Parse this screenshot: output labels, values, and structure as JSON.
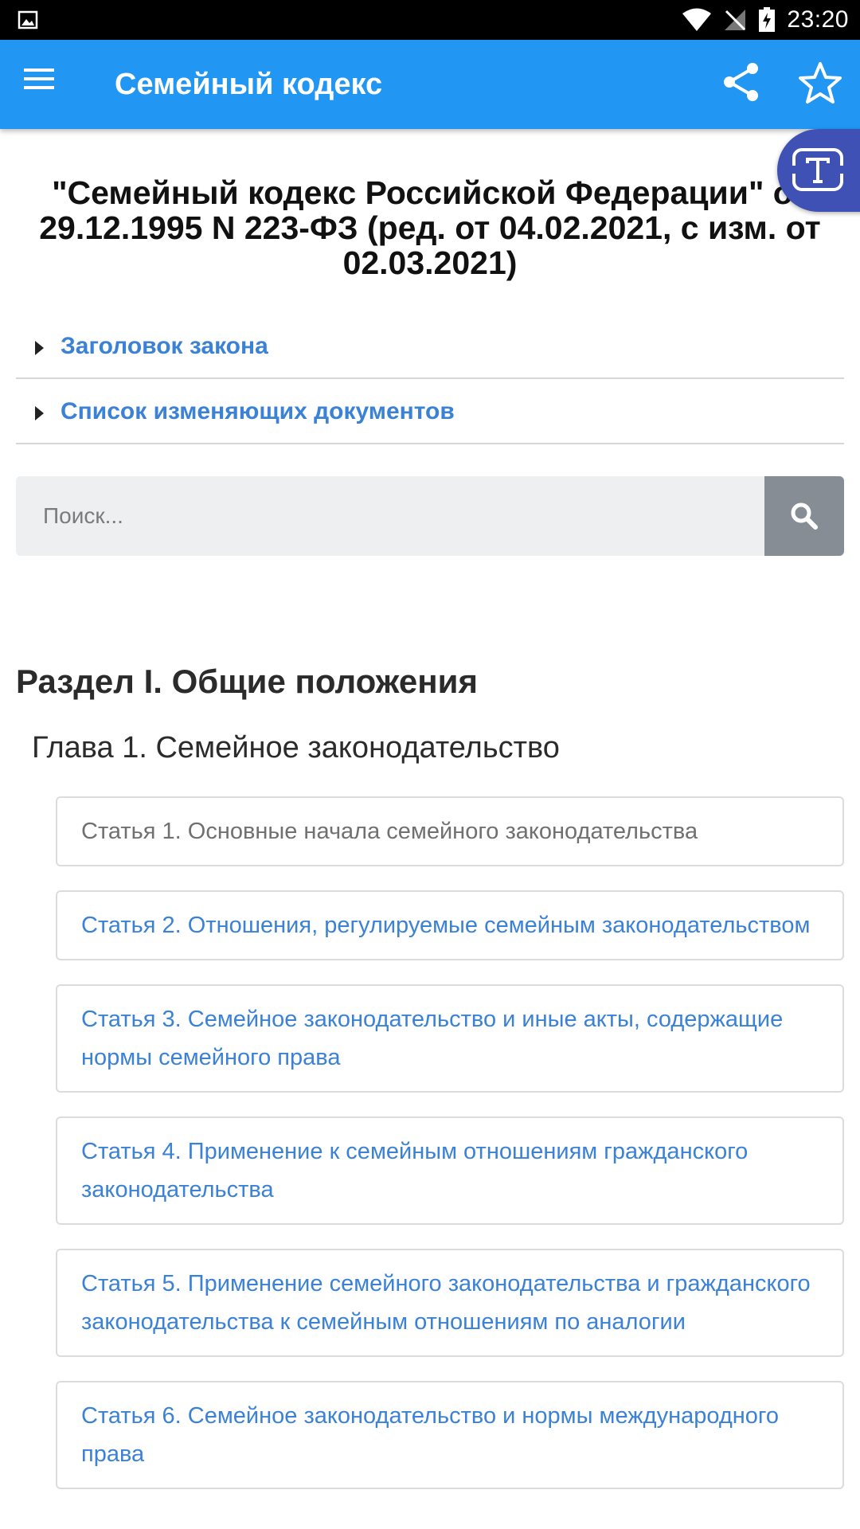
{
  "status_bar": {
    "time": "23:20",
    "icons": [
      "image-icon",
      "wifi-icon",
      "no-signal-icon",
      "battery-charging-icon"
    ]
  },
  "app_bar": {
    "title": "Семейный кодекс",
    "icons": [
      "menu-icon",
      "share-icon",
      "star-icon"
    ]
  },
  "fab": {
    "icon": "text-format-icon"
  },
  "document": {
    "title": "\"Семейный кодекс Российской Федерации\" от 29.12.1995 N 223-ФЗ (ред. от 04.02.2021, с изм. от 02.03.2021)"
  },
  "collapsibles": [
    {
      "label": "Заголовок закона"
    },
    {
      "label": "Список изменяющих документов"
    }
  ],
  "search": {
    "placeholder": "Поиск...",
    "value": ""
  },
  "section": {
    "title": "Раздел I. Общие положения"
  },
  "chapter": {
    "title": "Глава 1. Семейное законодательство"
  },
  "articles": [
    {
      "label": "Статья 1. Основные начала семейного законодательства",
      "visited": true
    },
    {
      "label": "Статья 2. Отношения, регулируемые семейным законодательством",
      "visited": false
    },
    {
      "label": "Статья 3. Семейное законодательство и иные акты, содержащие нормы семейного права",
      "visited": false
    },
    {
      "label": "Статья 4. Применение к семейным отношениям гражданского законодательства",
      "visited": false
    },
    {
      "label": "Статья 5. Применение семейного законодательства и гражданского законодательства к семейным отношениям по аналогии",
      "visited": false
    },
    {
      "label": "Статья 6. Семейное законодательство и нормы международного права",
      "visited": false
    }
  ],
  "colors": {
    "app_bar": "#2196f3",
    "link": "#3b82d6",
    "visited": "#707070",
    "fab": "#3f51b5",
    "search_button": "#868d94"
  }
}
